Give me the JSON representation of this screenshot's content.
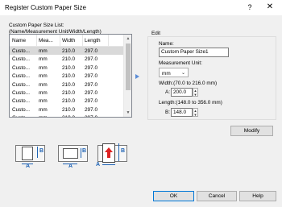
{
  "window": {
    "title": "Register Custom Paper Size",
    "help_glyph": "?",
    "close_glyph": "✕"
  },
  "list": {
    "label_line1": "Custom Paper Size List:",
    "label_line2": "(Name/Measurement Unit/Width/Length)",
    "columns": [
      "Name",
      "Mea...",
      "Width",
      "Length"
    ],
    "rows": [
      [
        "Custo...",
        "mm",
        "210.0",
        "297.0"
      ],
      [
        "Custo...",
        "mm",
        "210.0",
        "297.0"
      ],
      [
        "Custo...",
        "mm",
        "210.0",
        "297.0"
      ],
      [
        "Custo...",
        "mm",
        "210.0",
        "297.0"
      ],
      [
        "Custo...",
        "mm",
        "210.0",
        "297.0"
      ],
      [
        "Custo...",
        "mm",
        "210.0",
        "297.0"
      ],
      [
        "Custo...",
        "mm",
        "210.0",
        "297.0"
      ],
      [
        "Custo...",
        "mm",
        "210.0",
        "297.0"
      ],
      [
        "Custo...",
        "mm",
        "210.0",
        "297.0"
      ]
    ],
    "selected_index": 0
  },
  "edit": {
    "group_label": "Edit",
    "name_label": "Name:",
    "name_value": "Custom Paper Size1",
    "unit_label": "Measurement Unit:",
    "unit_value": "mm",
    "width_label": "Width:(70.0 to 216.0 mm)",
    "width_axis": "A:",
    "width_value": "200.0",
    "length_label": "Length:(148.0 to 356.0 mm)",
    "length_axis": "B:",
    "length_value": "148.0"
  },
  "buttons": {
    "modify": "Modify",
    "ok": "OK",
    "cancel": "Cancel",
    "help": "Help"
  },
  "colors": {
    "accent": "#1f63b5",
    "selection": "#d9d9d9",
    "default_border": "#0078d7",
    "arrow": "#5b8dd6"
  },
  "icons": {
    "help": "question-mark-icon",
    "close": "close-x-icon",
    "arrow": "triangle-right-icon"
  }
}
